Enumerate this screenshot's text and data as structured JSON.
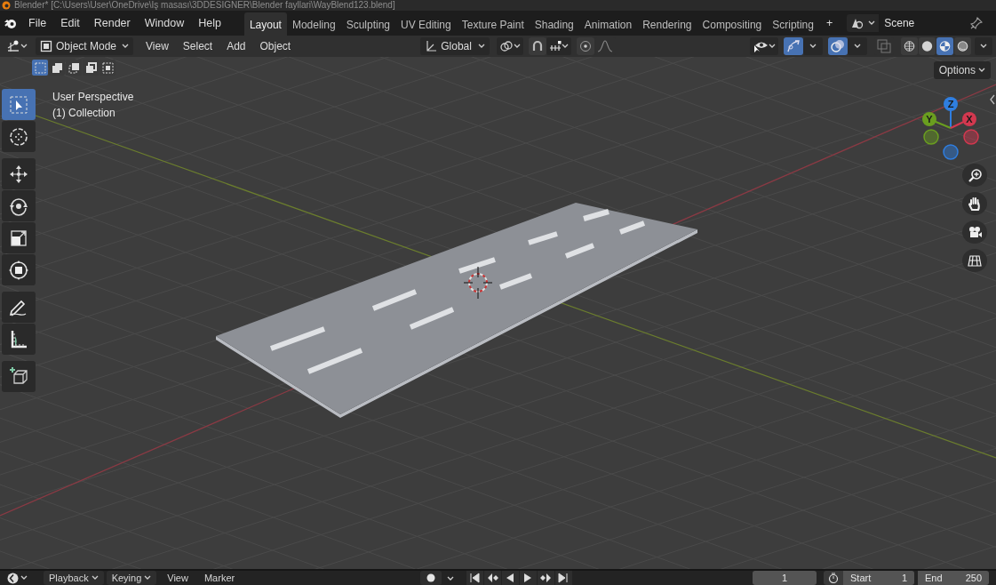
{
  "title_bar": {
    "title": "Blender* [C:\\Users\\User\\OneDrive\\İş masası\\3DDESIGNER\\Blender fayllari\\WayBlend123.blend]"
  },
  "menu": [
    "File",
    "Edit",
    "Render",
    "Window",
    "Help"
  ],
  "workspaces": [
    {
      "label": "Layout",
      "selected": true
    },
    {
      "label": "Modeling",
      "selected": false
    },
    {
      "label": "Sculpting",
      "selected": false
    },
    {
      "label": "UV Editing",
      "selected": false
    },
    {
      "label": "Texture Paint",
      "selected": false
    },
    {
      "label": "Shading",
      "selected": false
    },
    {
      "label": "Animation",
      "selected": false
    },
    {
      "label": "Rendering",
      "selected": false
    },
    {
      "label": "Compositing",
      "selected": false
    },
    {
      "label": "Scripting",
      "selected": false
    }
  ],
  "add_workspace": "+",
  "scene": {
    "name": "Scene"
  },
  "header": {
    "mode": "Object Mode",
    "menus": [
      "View",
      "Select",
      "Add",
      "Object"
    ],
    "orientation": "Global",
    "snap": {
      "on": false
    },
    "proportional": {
      "on": false
    },
    "gizmos": {
      "on": true
    },
    "overlays": {
      "on": true
    },
    "xray": {
      "on": false
    },
    "shading": [
      {
        "selected": false
      },
      {
        "selected": false
      },
      {
        "selected": true
      },
      {
        "selected": false
      }
    ],
    "options": "Options"
  },
  "selection_modes": [
    {
      "selected": true
    },
    {
      "selected": false
    },
    {
      "selected": false
    },
    {
      "selected": false
    },
    {
      "selected": false
    }
  ],
  "viewport_info": [
    "User Perspective",
    "(1) Collection"
  ],
  "tools": [
    {
      "kind": "select",
      "selected": true
    },
    {
      "kind": "cursor",
      "selected": false
    },
    {
      "kind": "move",
      "selected": false
    },
    {
      "kind": "rotate",
      "selected": false
    },
    {
      "kind": "scale",
      "selected": false
    },
    {
      "kind": "transform",
      "selected": false
    },
    {
      "kind": "annotate",
      "selected": false
    },
    {
      "kind": "measure",
      "selected": false
    },
    {
      "kind": "add_cube",
      "selected": false
    }
  ],
  "navigation_gizmo": {
    "axes": [
      {
        "label": "Z",
        "color": "#2f7ee0"
      },
      {
        "label": "Y",
        "color": "#6a9e1f"
      },
      {
        "label": "X",
        "color": "#d3384f"
      }
    ]
  },
  "timeline": {
    "menus": [
      {
        "label": "Playback",
        "dropdown": true
      },
      {
        "label": "Keying",
        "dropdown": true
      },
      {
        "label": "View",
        "dropdown": false
      },
      {
        "label": "Marker",
        "dropdown": false
      }
    ],
    "current_frame": "1",
    "start_label": "Start",
    "start": "1",
    "end_label": "End",
    "end": "250"
  }
}
